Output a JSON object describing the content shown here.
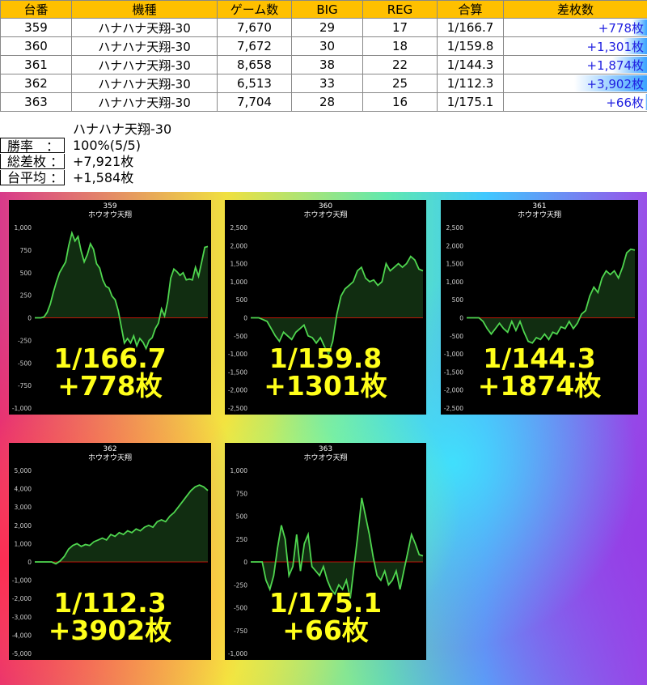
{
  "table": {
    "headers": [
      "台番",
      "機種",
      "ゲーム数",
      "BIG",
      "REG",
      "合算",
      "差枚数"
    ],
    "rows": [
      {
        "no": "359",
        "model": "ハナハナ天翔-30",
        "games": "7,670",
        "big": "29",
        "reg": "17",
        "combined": "1/166.7",
        "diff": "+778枚",
        "diff_value": 778
      },
      {
        "no": "360",
        "model": "ハナハナ天翔-30",
        "games": "7,672",
        "big": "30",
        "reg": "18",
        "combined": "1/159.8",
        "diff": "+1,301枚",
        "diff_value": 1301
      },
      {
        "no": "361",
        "model": "ハナハナ天翔-30",
        "games": "8,658",
        "big": "38",
        "reg": "22",
        "combined": "1/144.3",
        "diff": "+1,874枚",
        "diff_value": 1874
      },
      {
        "no": "362",
        "model": "ハナハナ天翔-30",
        "games": "6,513",
        "big": "33",
        "reg": "25",
        "combined": "1/112.3",
        "diff": "+3,902枚",
        "diff_value": 3902
      },
      {
        "no": "363",
        "model": "ハナハナ天翔-30",
        "games": "7,704",
        "big": "28",
        "reg": "16",
        "combined": "1/175.1",
        "diff": "+66枚",
        "diff_value": 66
      }
    ]
  },
  "summary": {
    "model": "ハナハナ天翔-30",
    "win_rate_label": "勝率　：",
    "win_rate": "100%(5/5)",
    "total_label": "総差枚 ：",
    "total": "+7,921枚",
    "avg_label": "台平均 ：",
    "avg": "+1,584枚"
  },
  "colors": {
    "header": "#ffc000",
    "diff_text": "#1f1fe0",
    "chart_bg": "#000000",
    "line": "#4fd64f",
    "zero": "#cc0000",
    "overlay": "#ffff1a"
  },
  "chart_data": [
    {
      "type": "area",
      "title": "359",
      "subtitle": "ホウオウ天翔",
      "ylim": [
        -1000,
        1000
      ],
      "yticks": [
        "1,000",
        "750",
        "500",
        "250",
        "0",
        "-250",
        "-500",
        "-750",
        "-1,000"
      ],
      "overlay1": "1/166.7",
      "overlay2": "+778枚",
      "y": [
        0,
        0,
        0,
        10,
        60,
        150,
        280,
        400,
        500,
        560,
        620,
        800,
        940,
        850,
        900,
        740,
        620,
        700,
        820,
        760,
        600,
        550,
        420,
        350,
        330,
        240,
        200,
        80,
        -100,
        -280,
        -230,
        -280,
        -200,
        -310,
        -230,
        -270,
        -340,
        -250,
        -220,
        -120,
        -60,
        100,
        20,
        180,
        440,
        540,
        510,
        470,
        500,
        420,
        430,
        420,
        560,
        460,
        620,
        780,
        790
      ]
    },
    {
      "type": "area",
      "title": "360",
      "subtitle": "ホウオウ天翔",
      "ylim": [
        -2500,
        2500
      ],
      "yticks": [
        "2,500",
        "2,000",
        "1,500",
        "1,000",
        "500",
        "0",
        "-500",
        "-1,000",
        "-1,500",
        "-2,000",
        "-2,500"
      ],
      "overlay1": "1/159.8",
      "overlay2": "+1301枚",
      "y": [
        0,
        0,
        0,
        -50,
        -100,
        -300,
        -500,
        -650,
        -400,
        -500,
        -600,
        -400,
        -300,
        -200,
        -500,
        -550,
        -700,
        -550,
        -800,
        -1000,
        -650,
        100,
        600,
        800,
        900,
        1000,
        1300,
        1400,
        1100,
        1000,
        1050,
        900,
        1000,
        1500,
        1300,
        1400,
        1500,
        1400,
        1500,
        1700,
        1600,
        1350,
        1301
      ]
    },
    {
      "type": "area",
      "title": "361",
      "subtitle": "ホウオウ天翔",
      "ylim": [
        -2500,
        2500
      ],
      "yticks": [
        "2,500",
        "2,000",
        "1,500",
        "1,000",
        "500",
        "0",
        "-500",
        "-1,000",
        "-1,500",
        "-2,000",
        "-2,500"
      ],
      "overlay1": "1/144.3",
      "overlay2": "+1874枚",
      "y": [
        0,
        0,
        0,
        0,
        -100,
        -300,
        -450,
        -300,
        -150,
        -300,
        -400,
        -100,
        -350,
        -100,
        -400,
        -650,
        -700,
        -550,
        -600,
        -450,
        -600,
        -400,
        -450,
        -250,
        -300,
        -100,
        -300,
        -150,
        100,
        200,
        600,
        850,
        700,
        1100,
        1300,
        1200,
        1300,
        1100,
        1400,
        1800,
        1900,
        1874
      ]
    },
    {
      "type": "area",
      "title": "362",
      "subtitle": "ホウオウ天翔",
      "ylim": [
        -5000,
        5000
      ],
      "yticks": [
        "5,000",
        "4,000",
        "3,000",
        "2,000",
        "1,000",
        "0",
        "-1,000",
        "-2,000",
        "-3,000",
        "-4,000",
        "-5,000"
      ],
      "overlay1": "1/112.3",
      "overlay2": "+3902枚",
      "y": [
        0,
        0,
        0,
        0,
        0,
        -100,
        50,
        300,
        700,
        900,
        1000,
        850,
        950,
        900,
        1100,
        1200,
        1300,
        1200,
        1500,
        1400,
        1600,
        1500,
        1700,
        1600,
        1800,
        1700,
        1900,
        2000,
        1900,
        2200,
        2300,
        2200,
        2500,
        2700,
        3000,
        3300,
        3600,
        3900,
        4100,
        4200,
        4100,
        3902
      ]
    },
    {
      "type": "area",
      "title": "363",
      "subtitle": "ホウオウ天翔",
      "ylim": [
        -1000,
        1000
      ],
      "yticks": [
        "1,000",
        "750",
        "500",
        "250",
        "0",
        "-250",
        "-500",
        "-750",
        "-1,000"
      ],
      "overlay1": "1/175.1",
      "overlay2": "+66枚",
      "y": [
        0,
        0,
        0,
        0,
        -200,
        -300,
        -150,
        150,
        400,
        250,
        -150,
        -50,
        300,
        -100,
        200,
        300,
        -50,
        -100,
        -150,
        -50,
        -200,
        -300,
        -350,
        -250,
        -300,
        -200,
        -400,
        -50,
        300,
        700,
        500,
        300,
        50,
        -150,
        -200,
        -100,
        -250,
        -200,
        -100,
        -300,
        -100,
        100,
        300,
        200,
        80,
        66
      ]
    }
  ]
}
